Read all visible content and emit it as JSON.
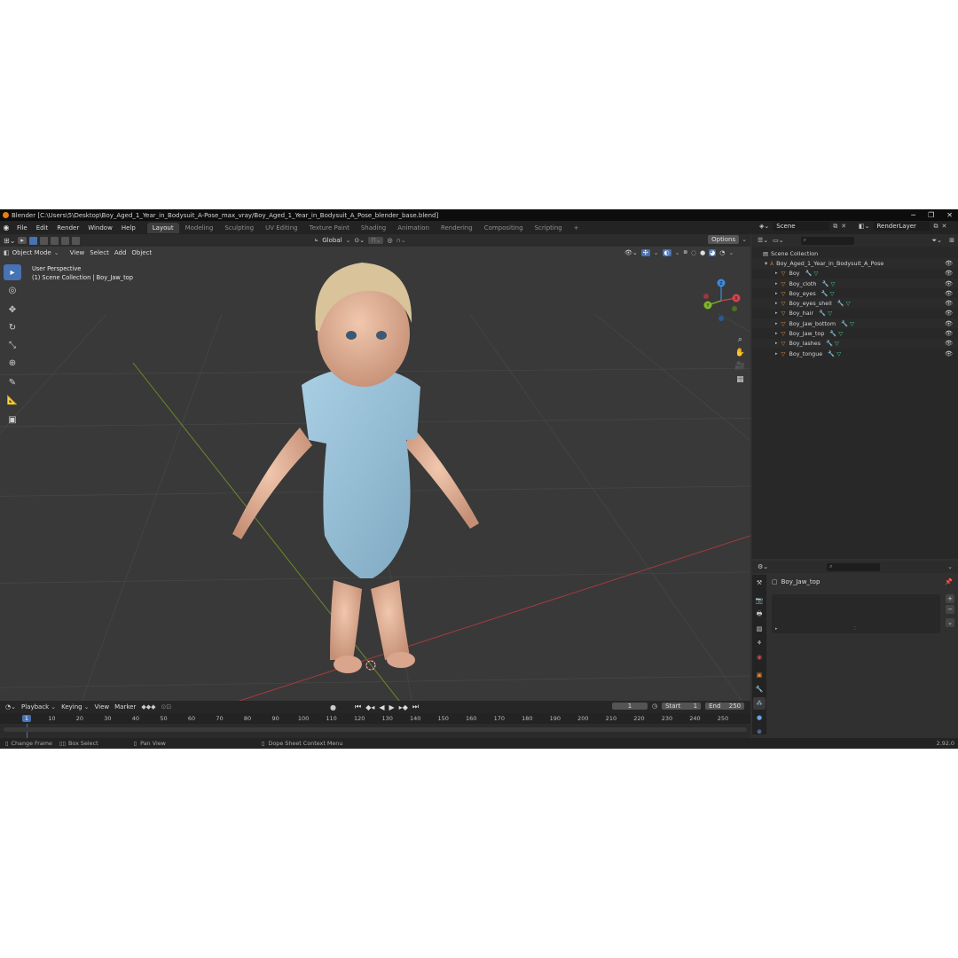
{
  "window": {
    "title": "Blender [C:\\Users\\5\\Desktop\\Boy_Aged_1_Year_in_Bodysuit_A-Pose_max_vray/Boy_Aged_1_Year_in_Bodysuit_A_Pose_blender_base.blend]",
    "minimize": "─",
    "maximize": "❐",
    "close": "✕"
  },
  "menu": {
    "items": [
      "File",
      "Edit",
      "Render",
      "Window",
      "Help"
    ],
    "workspaces": [
      "Layout",
      "Modeling",
      "Sculpting",
      "UV Editing",
      "Texture Paint",
      "Shading",
      "Animation",
      "Rendering",
      "Compositing",
      "Scripting"
    ],
    "active_workspace": "Layout",
    "add_tab": "+",
    "scene_label": "Scene",
    "render_layer_label": "RenderLayer"
  },
  "viewport": {
    "mode": "Object Mode",
    "menus": [
      "View",
      "Select",
      "Add",
      "Object"
    ],
    "transform_orientation": "Global",
    "options": "Options",
    "overlay_title": "User Perspective",
    "overlay_subtitle": "(1) Scene Collection | Boy_Jaw_top",
    "gizmo_axes": {
      "x": "X",
      "y": "Y",
      "z": "Z"
    }
  },
  "outliner": {
    "root": "Scene Collection",
    "parent": "Boy_Aged_1_Year_in_Bodysuit_A_Pose",
    "items": [
      "Boy",
      "Boy_cloth",
      "Boy_eyes",
      "Boy_eyes_shell",
      "Boy_hair",
      "Boy_Jaw_bottom",
      "Boy_Jaw_top",
      "Boy_lashes",
      "Boy_tongue"
    ]
  },
  "properties": {
    "object_name": "Boy_Jaw_top"
  },
  "timeline": {
    "menus": [
      "Playback",
      "Keying",
      "View",
      "Marker"
    ],
    "current_frame": "1",
    "start_label": "Start",
    "start": "1",
    "end_label": "End",
    "end": "250",
    "ruler_ticks": [
      "1",
      "10",
      "20",
      "30",
      "40",
      "50",
      "60",
      "70",
      "80",
      "90",
      "100",
      "110",
      "120",
      "130",
      "140",
      "150",
      "160",
      "170",
      "180",
      "190",
      "200",
      "210",
      "220",
      "230",
      "240",
      "250"
    ]
  },
  "statusbar": {
    "change_frame": "Change Frame",
    "box_select": "Box Select",
    "pan_view": "Pan View",
    "context_menu": "Dope Sheet Context Menu",
    "version": "2.92.0"
  },
  "colors": {
    "accent": "#4772b3",
    "object_orange": "#e0873a",
    "mesh_green": "#3fc99a",
    "x_axis": "#d6424f",
    "y_axis": "#7fb827",
    "z_axis": "#3d8be0"
  }
}
